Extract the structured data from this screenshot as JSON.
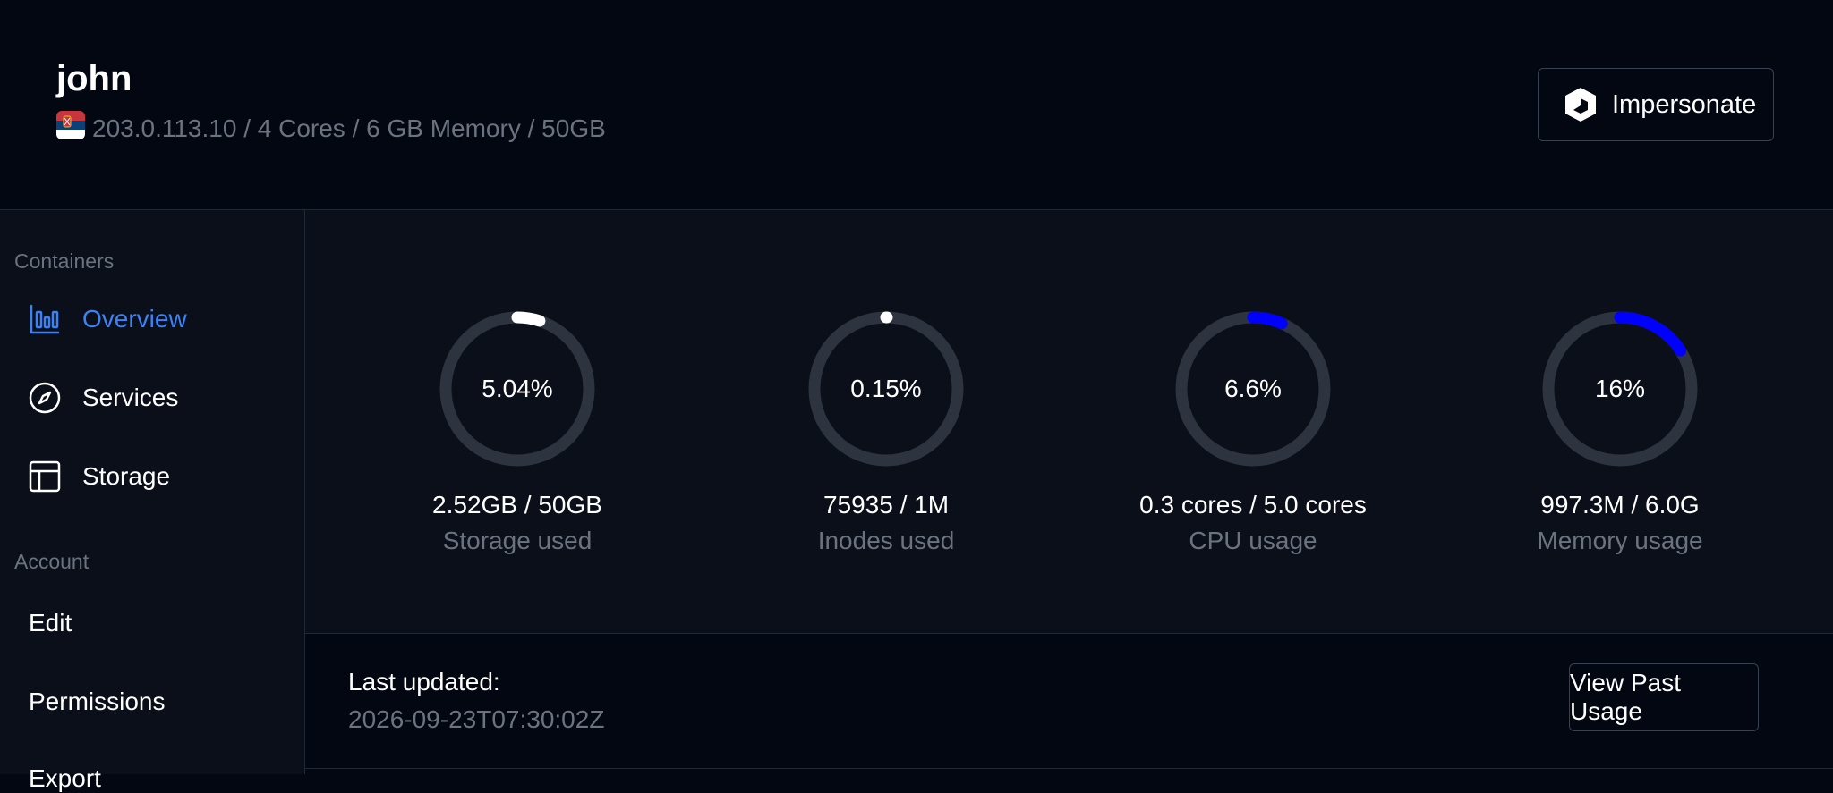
{
  "header": {
    "user_name": "john",
    "flag_icon": "serbia-flag-icon",
    "server_info": "203.0.113.10 / 4 Cores / 6 GB Memory / 50GB",
    "impersonate_label": "Impersonate"
  },
  "sidebar": {
    "containers_label": "Containers",
    "containers_items": [
      {
        "label": "Overview",
        "icon": "bar-chart-icon",
        "active": true
      },
      {
        "label": "Services",
        "icon": "compass-icon",
        "active": false
      },
      {
        "label": "Storage",
        "icon": "table-icon",
        "active": false
      }
    ],
    "account_label": "Account",
    "account_items": [
      {
        "label": "Edit"
      },
      {
        "label": "Permissions"
      },
      {
        "label": "Export"
      }
    ]
  },
  "stats": [
    {
      "percent": "5.04%",
      "fraction": 0.0504,
      "value": "2.52GB / 50GB",
      "caption": "Storage used",
      "color": "#ffffff"
    },
    {
      "percent": "0.15%",
      "fraction": 0.0015,
      "value": "75935 / 1M",
      "caption": "Inodes used",
      "color": "#ffffff"
    },
    {
      "percent": "6.6%",
      "fraction": 0.066,
      "value": "0.3 cores / 5.0 cores",
      "caption": "CPU usage",
      "color": "#0000ff"
    },
    {
      "percent": "16%",
      "fraction": 0.16,
      "value": "997.3M / 6.0G",
      "caption": "Memory usage",
      "color": "#0000ff"
    }
  ],
  "footer": {
    "last_updated_label": "Last updated:",
    "last_updated_value": "2026-09-23T07:30:02Z",
    "view_past_label": "View Past Usage"
  },
  "colors": {
    "accent": "#3b82f6",
    "ring_track": "#2d333f",
    "background": "#030712",
    "panel": "#0b0f19"
  }
}
